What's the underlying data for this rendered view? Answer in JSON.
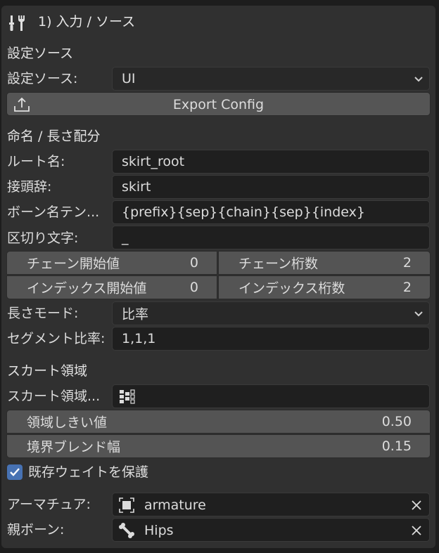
{
  "panel": {
    "title": "1) 入力 / ソース"
  },
  "source_section": {
    "heading": "設定ソース",
    "label": "設定ソース:",
    "value": "UI",
    "export_button": "Export Config"
  },
  "naming_section": {
    "heading": "命名 / 長さ配分",
    "root_label": "ルート名:",
    "root_value": "skirt_root",
    "prefix_label": "接頭辞:",
    "prefix_value": "skirt",
    "template_label": "ボーン名テン...",
    "template_value": "{prefix}{sep}{chain}{sep}{index}",
    "sep_label": "区切り文字:",
    "sep_value": "_",
    "chain_start_label": "チェーン開始値",
    "chain_start_value": "0",
    "chain_digits_label": "チェーン桁数",
    "chain_digits_value": "2",
    "index_start_label": "インデックス開始値",
    "index_start_value": "0",
    "index_digits_label": "インデックス桁数",
    "index_digits_value": "2",
    "length_mode_label": "長さモード:",
    "length_mode_value": "比率",
    "segment_ratio_label": "セグメント比率:",
    "segment_ratio_value": "1,1,1"
  },
  "skirt_section": {
    "heading": "スカート領域",
    "region_label": "スカート領域...",
    "threshold_label": "領域しきい値",
    "threshold_value": "0.50",
    "blend_label": "境界ブレンド幅",
    "blend_value": "0.15"
  },
  "protect": {
    "label": "既存ウェイトを保護",
    "checked": true
  },
  "armature": {
    "label": "アーマチュア:",
    "value": "armature"
  },
  "parent_bone": {
    "label": "親ボーン:",
    "value": "Hips"
  },
  "colors": {
    "accent": "#4772b3",
    "panel": "#303030",
    "field": "#1f1f1f",
    "button": "#555555"
  }
}
